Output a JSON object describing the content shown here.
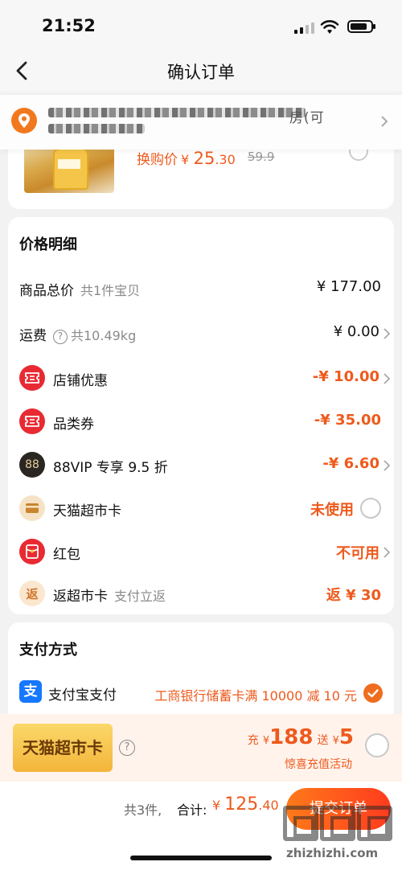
{
  "status_bar": {
    "time": "21:52"
  },
  "nav": {
    "title": "确认订单"
  },
  "address": {
    "text_tail": "房(可"
  },
  "product": {
    "price_label": "换购价",
    "currency": "¥",
    "price_int": "25",
    "price_dec": ".30",
    "original_price": "59.9"
  },
  "price_detail": {
    "title": "价格明细",
    "rows": [
      {
        "label": "商品总价",
        "sub": "共1件宝贝",
        "value": "¥ 177.00"
      },
      {
        "label": "运费",
        "help": "?",
        "sub": "共10.49kg",
        "value": "¥ 0.00"
      },
      {
        "label": "店铺优惠",
        "value": "-¥ 10.00"
      },
      {
        "label": "品类券",
        "value": "-¥ 35.00"
      },
      {
        "label": "88VIP 专享 9.5 折",
        "icon_text": "88",
        "value": "-¥ 6.60"
      },
      {
        "label": "天猫超市卡",
        "value": "未使用"
      },
      {
        "label": "红包",
        "value": "不可用"
      },
      {
        "label": "返超市卡",
        "icon_text": "返",
        "sub": "支付立返",
        "value": "返 ¥ 30"
      }
    ]
  },
  "payment": {
    "title": "支付方式",
    "method_icon_text": "支",
    "method": "支付宝支付",
    "promo": "工商银行储蓄卡满 10000 减 10 元"
  },
  "supermarket_card": {
    "badge": "天猫超市卡",
    "help": "?",
    "recharge_prefix": "充",
    "currency": "¥",
    "recharge_amount": "188",
    "gift_prefix": "送",
    "gift_amount": "5",
    "caption": "惊喜充值活动"
  },
  "bottom_bar": {
    "count": "共3件,",
    "total_label": "合计:",
    "currency": "¥",
    "total_int": "125",
    "total_dec": ".40",
    "submit": "提交订单",
    "watermark": "zhizhizhi.com"
  },
  "colors": {
    "accent": "#ee5a1c",
    "alipay": "#1677ff",
    "location": "#f2781e"
  }
}
